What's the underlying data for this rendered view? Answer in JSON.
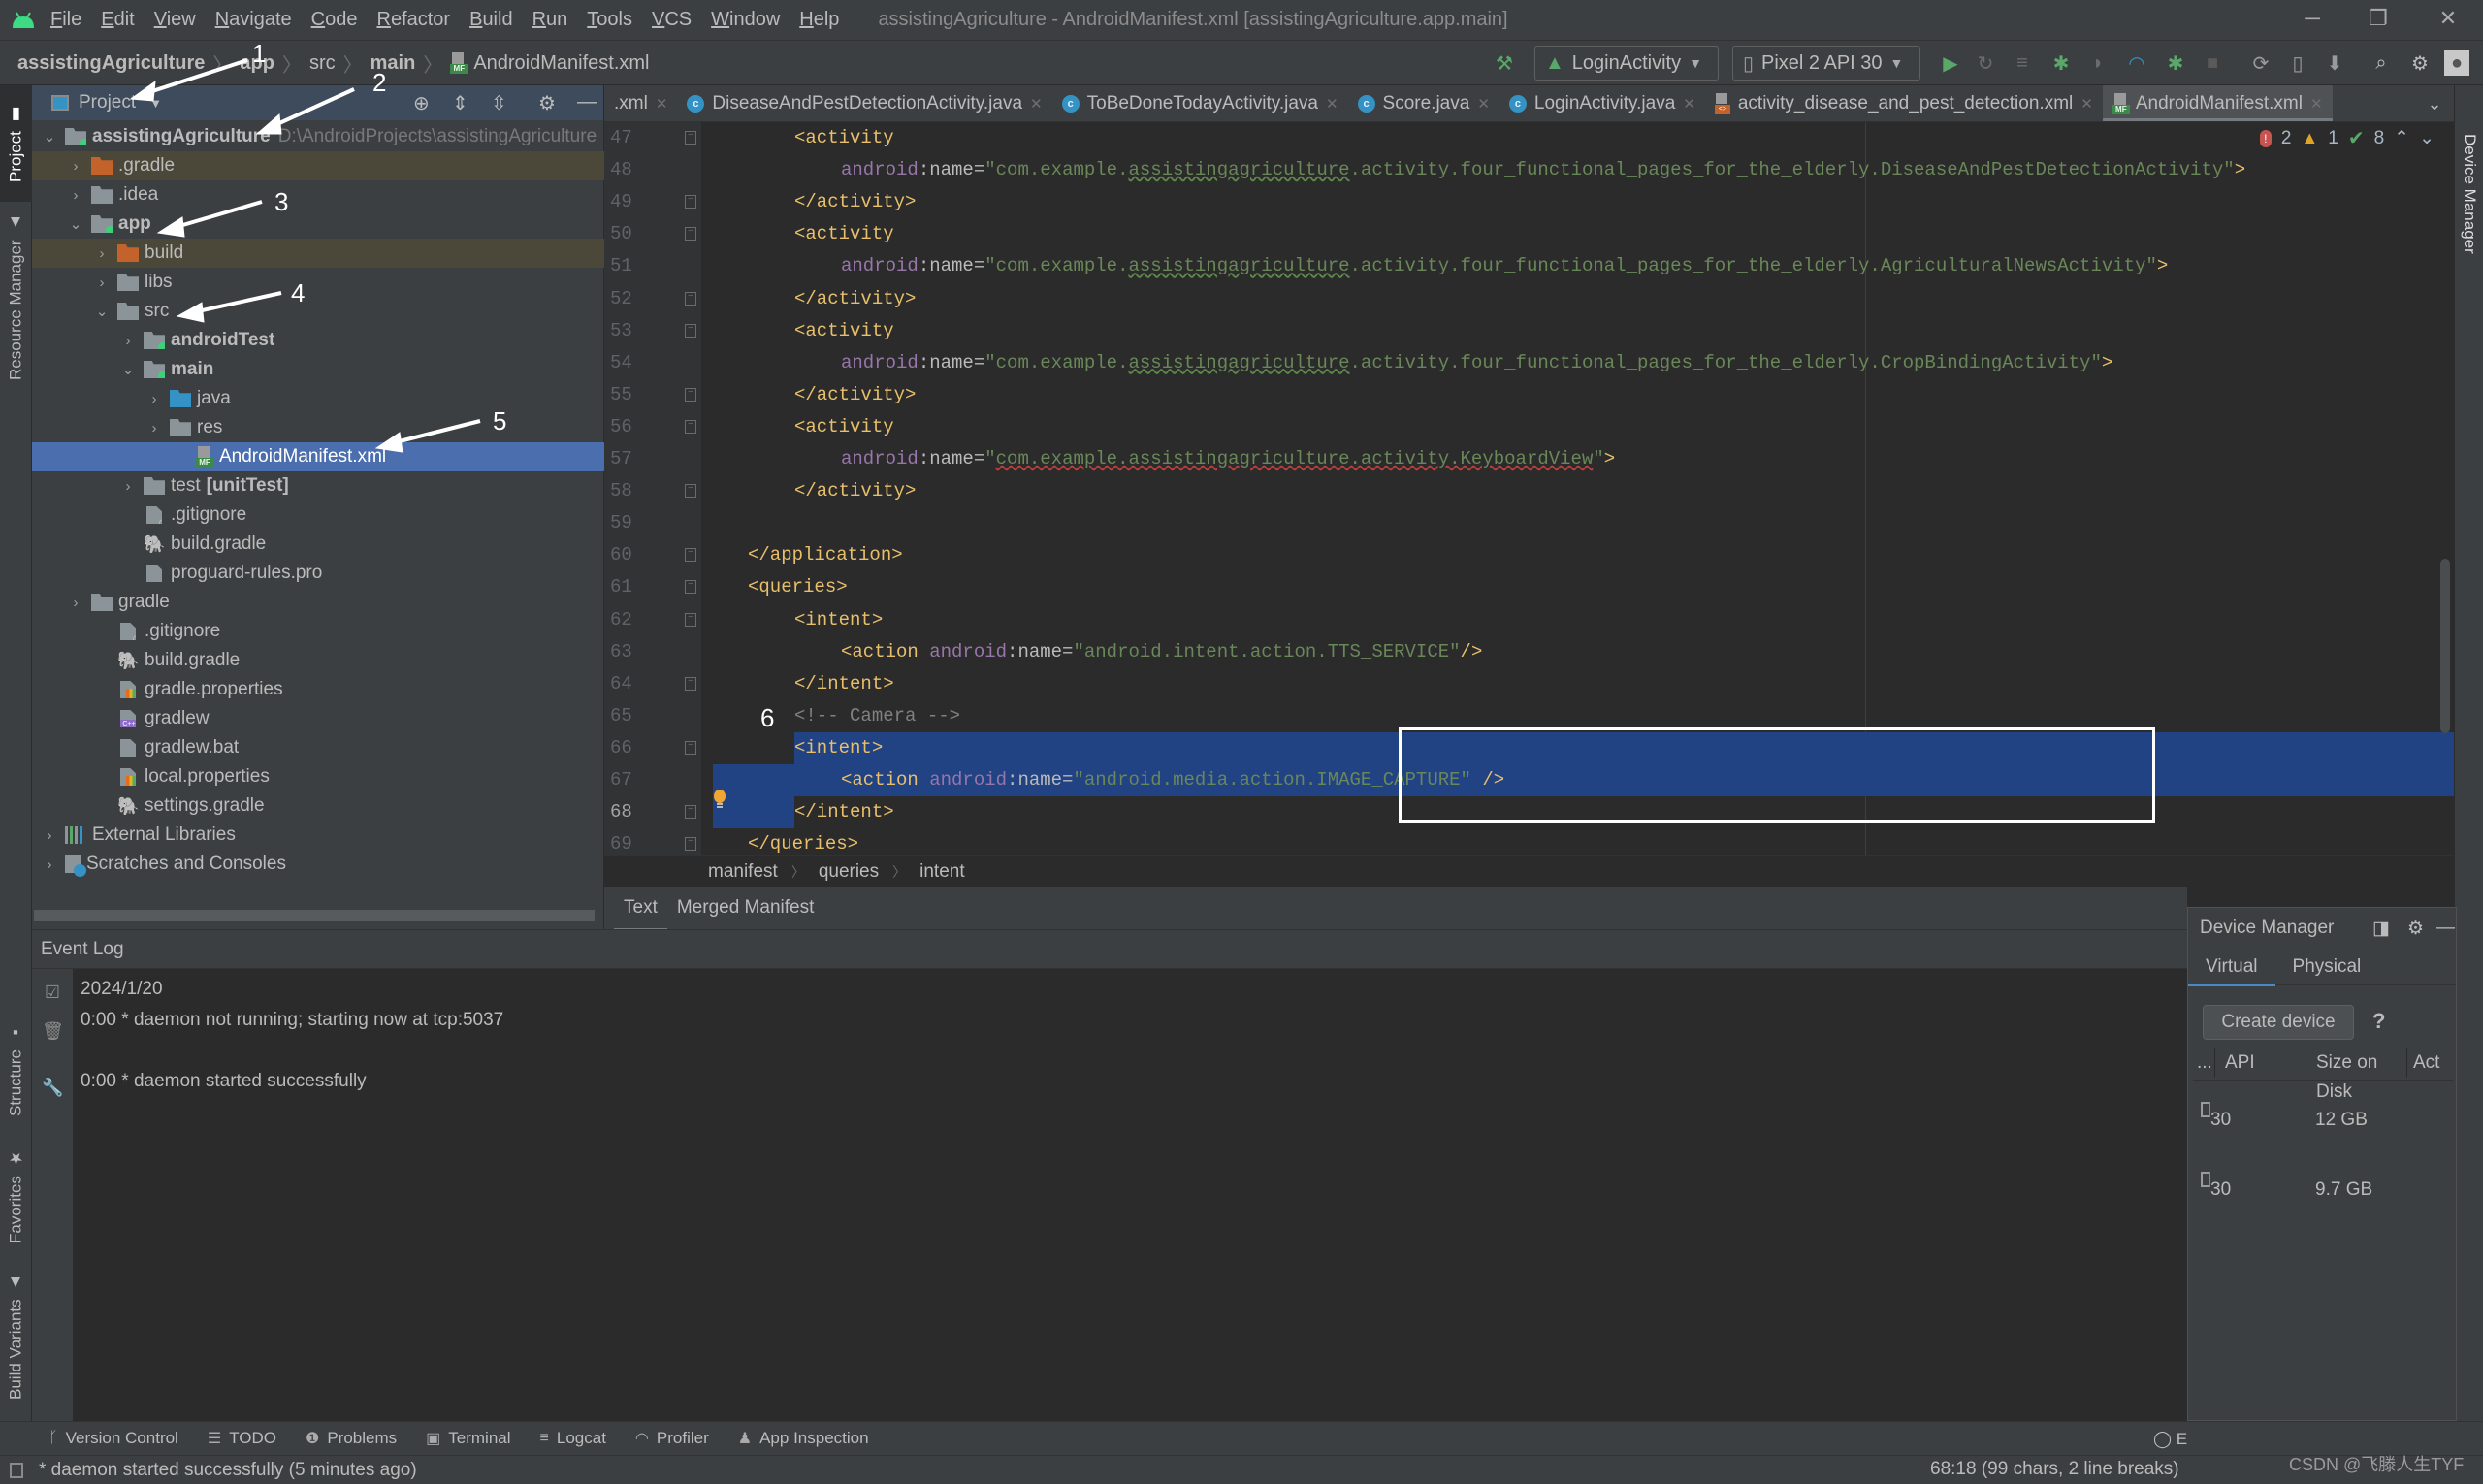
{
  "window": {
    "title": "assistingAgriculture - AndroidManifest.xml [assistingAgriculture.app.main]",
    "menu": [
      "File",
      "Edit",
      "View",
      "Navigate",
      "Code",
      "Refactor",
      "Build",
      "Run",
      "Tools",
      "VCS",
      "Window",
      "Help"
    ],
    "controls": {
      "minimize": "─",
      "restore": "❐",
      "close": "✕"
    }
  },
  "breadcrumb": {
    "items": [
      "assistingAgriculture",
      "app",
      "src",
      "main",
      "AndroidManifest.xml"
    ]
  },
  "toolbar": {
    "run_config": "LoginActivity",
    "device": "Pixel 2 API 30",
    "icons": [
      "hammer-icon",
      "run-icon",
      "rerun-icon",
      "apply-changes-icon",
      "debug-icon",
      "coverage-icon",
      "profile-icon",
      "attach-debugger-icon",
      "stop-icon",
      "sync-gradle-icon",
      "device-manager-icon",
      "sdk-manager-icon",
      "search-icon",
      "settings-icon",
      "account-icon"
    ]
  },
  "left_strip": {
    "top": [
      "Project",
      "Resource Manager"
    ],
    "bottom": [
      "Structure",
      "Favorites",
      "Build Variants"
    ]
  },
  "right_strip": {
    "label": "Device Manager"
  },
  "project_panel": {
    "view_mode": "Project",
    "tree": [
      {
        "label": "assistingAgriculture",
        "path": "D:\\AndroidProjects\\assistingAgriculture",
        "depth": 0,
        "expanded": true,
        "icon": "project",
        "bold": true
      },
      {
        "label": ".gradle",
        "depth": 1,
        "expanded": false,
        "icon": "folder-orange",
        "excluded": true
      },
      {
        "label": ".idea",
        "depth": 1,
        "expanded": false,
        "icon": "folder"
      },
      {
        "label": "app",
        "depth": 1,
        "expanded": true,
        "icon": "module",
        "bold": true
      },
      {
        "label": "build",
        "depth": 2,
        "expanded": false,
        "icon": "folder-orange",
        "excluded": true
      },
      {
        "label": "libs",
        "depth": 2,
        "expanded": false,
        "icon": "folder"
      },
      {
        "label": "src",
        "depth": 2,
        "expanded": true,
        "icon": "folder"
      },
      {
        "label": "androidTest",
        "depth": 3,
        "expanded": false,
        "icon": "module",
        "bold": true
      },
      {
        "label": "main",
        "depth": 3,
        "expanded": true,
        "icon": "module",
        "bold": true
      },
      {
        "label": "java",
        "depth": 4,
        "expanded": false,
        "icon": "folder-blue"
      },
      {
        "label": "res",
        "depth": 4,
        "expanded": false,
        "icon": "folder"
      },
      {
        "label": "AndroidManifest.xml",
        "depth": 5,
        "icon": "mf",
        "selected": true
      },
      {
        "label": "test",
        "suffix": "[unitTest]",
        "depth": 3,
        "expanded": false,
        "icon": "folder"
      },
      {
        "label": ".gitignore",
        "depth": 3,
        "icon": "ignore"
      },
      {
        "label": "build.gradle",
        "depth": 3,
        "icon": "gradle"
      },
      {
        "label": "proguard-rules.pro",
        "depth": 3,
        "icon": "file"
      },
      {
        "label": "gradle",
        "depth": 1,
        "expanded": false,
        "icon": "folder"
      },
      {
        "label": ".gitignore",
        "depth": 2,
        "icon": "ignore"
      },
      {
        "label": "build.gradle",
        "depth": 2,
        "icon": "gradle"
      },
      {
        "label": "gradle.properties",
        "depth": 2,
        "icon": "props"
      },
      {
        "label": "gradlew",
        "depth": 2,
        "icon": "cpp"
      },
      {
        "label": "gradlew.bat",
        "depth": 2,
        "icon": "file"
      },
      {
        "label": "local.properties",
        "depth": 2,
        "icon": "props"
      },
      {
        "label": "settings.gradle",
        "depth": 2,
        "icon": "gradle"
      },
      {
        "label": "External Libraries",
        "depth": 0,
        "expanded": false,
        "icon": "libs"
      },
      {
        "label": "Scratches and Consoles",
        "depth": 0,
        "expanded": false,
        "icon": "scratch"
      }
    ]
  },
  "annotations": [
    "1",
    "2",
    "3",
    "4",
    "5",
    "6"
  ],
  "editor": {
    "tabs": [
      {
        "label": ".xml",
        "icon": "xml",
        "partial": true
      },
      {
        "label": "DiseaseAndPestDetectionActivity.java",
        "icon": "class"
      },
      {
        "label": "ToBeDoneTodayActivity.java",
        "icon": "class"
      },
      {
        "label": "Score.java",
        "icon": "class"
      },
      {
        "label": "LoginActivity.java",
        "icon": "class"
      },
      {
        "label": "activity_disease_and_pest_detection.xml",
        "icon": "xml"
      },
      {
        "label": "AndroidManifest.xml",
        "icon": "mf",
        "active": true
      }
    ],
    "inspections": {
      "errors": "2",
      "warnings": "1",
      "ok": "8"
    },
    "lines": [
      {
        "n": "47",
        "indent": 2,
        "parts": [
          [
            "tag",
            "<activity"
          ]
        ]
      },
      {
        "n": "48",
        "indent": 3,
        "parts": [
          [
            "ns",
            "android"
          ],
          [
            "attr",
            ":name="
          ],
          [
            "str",
            "\"com.example."
          ],
          [
            "strg",
            "assistingagriculture"
          ],
          [
            "str",
            ".activity.four_functional_pages_for_the_elderly.DiseaseAndPestDetectionActivity\""
          ],
          [
            "tag",
            ">"
          ]
        ]
      },
      {
        "n": "49",
        "indent": 2,
        "parts": [
          [
            "tag",
            "</activity>"
          ]
        ]
      },
      {
        "n": "50",
        "indent": 2,
        "parts": [
          [
            "tag",
            "<activity"
          ]
        ]
      },
      {
        "n": "51",
        "indent": 3,
        "parts": [
          [
            "ns",
            "android"
          ],
          [
            "attr",
            ":name="
          ],
          [
            "str",
            "\"com.example."
          ],
          [
            "strg",
            "assistingagriculture"
          ],
          [
            "str",
            ".activity.four_functional_pages_for_the_elderly.AgriculturalNewsActivity\""
          ],
          [
            "tag",
            ">"
          ]
        ]
      },
      {
        "n": "52",
        "indent": 2,
        "parts": [
          [
            "tag",
            "</activity>"
          ]
        ]
      },
      {
        "n": "53",
        "indent": 2,
        "parts": [
          [
            "tag",
            "<activity"
          ]
        ]
      },
      {
        "n": "54",
        "indent": 3,
        "parts": [
          [
            "ns",
            "android"
          ],
          [
            "attr",
            ":name="
          ],
          [
            "str",
            "\"com.example."
          ],
          [
            "strg",
            "assistingagriculture"
          ],
          [
            "str",
            ".activity.four_functional_pages_for_the_elderly.CropBindingActivity\""
          ],
          [
            "tag",
            ">"
          ]
        ]
      },
      {
        "n": "55",
        "indent": 2,
        "parts": [
          [
            "tag",
            "</activity>"
          ]
        ]
      },
      {
        "n": "56",
        "indent": 2,
        "parts": [
          [
            "tag",
            "<activity"
          ]
        ]
      },
      {
        "n": "57",
        "indent": 3,
        "parts": [
          [
            "ns",
            "android"
          ],
          [
            "attr",
            ":name="
          ],
          [
            "str",
            "\""
          ],
          [
            "strr",
            "com.example.assistingagriculture.activity.KeyboardView"
          ],
          [
            "str",
            "\""
          ],
          [
            "tag",
            ">"
          ]
        ]
      },
      {
        "n": "58",
        "indent": 2,
        "parts": [
          [
            "tag",
            "</activity>"
          ]
        ]
      },
      {
        "n": "59",
        "indent": 0,
        "parts": []
      },
      {
        "n": "60",
        "indent": 1,
        "parts": [
          [
            "tag",
            "</application>"
          ]
        ]
      },
      {
        "n": "61",
        "indent": 1,
        "parts": [
          [
            "tag",
            "<queries>"
          ]
        ]
      },
      {
        "n": "62",
        "indent": 2,
        "parts": [
          [
            "tag",
            "<intent>"
          ]
        ]
      },
      {
        "n": "63",
        "indent": 3,
        "parts": [
          [
            "tag",
            "<action "
          ],
          [
            "ns",
            "android"
          ],
          [
            "attr",
            ":name="
          ],
          [
            "str",
            "\"android.intent.action.TTS_SERVICE\""
          ],
          [
            "tag",
            "/>"
          ]
        ]
      },
      {
        "n": "64",
        "indent": 2,
        "parts": [
          [
            "tag",
            "</intent>"
          ]
        ]
      },
      {
        "n": "65",
        "indent": 2,
        "parts": [
          [
            "cmt",
            "<!-- Camera -->"
          ]
        ]
      },
      {
        "n": "66",
        "indent": 2,
        "parts": [
          [
            "tag",
            "<intent>"
          ]
        ],
        "selected": true
      },
      {
        "n": "67",
        "indent": 3,
        "parts": [
          [
            "tag",
            "<action "
          ],
          [
            "ns",
            "android"
          ],
          [
            "attr",
            ":name="
          ],
          [
            "str",
            "\"android.media.action.IMAGE_CAPTURE\""
          ],
          [
            "attr",
            " "
          ],
          [
            "tag",
            "/>"
          ]
        ],
        "selected": true
      },
      {
        "n": "68",
        "indent": 2,
        "parts": [
          [
            "tag",
            "</intent>"
          ]
        ],
        "selected": true,
        "current": true
      },
      {
        "n": "69",
        "indent": 1,
        "parts": [
          [
            "tag",
            "</queries>"
          ]
        ]
      }
    ],
    "crumbs": [
      "manifest",
      "queries",
      "intent"
    ],
    "subtabs": [
      {
        "label": "Text",
        "active": true
      },
      {
        "label": "Merged Manifest"
      }
    ]
  },
  "event_log": {
    "title": "Event Log",
    "date": "2024/1/20",
    "entries": [
      {
        "time": "0:00",
        "text": "* daemon not running; starting now at tcp:5037"
      },
      {
        "time": "0:00",
        "text": "* daemon started successfully"
      }
    ]
  },
  "device_manager": {
    "title": "Device Manager",
    "tabs": [
      {
        "label": "Virtual",
        "active": true
      },
      {
        "label": "Physical"
      }
    ],
    "create_button": "Create device",
    "help": "?",
    "columns": [
      "...",
      "API",
      "Size on Disk",
      "Act"
    ],
    "rows": [
      {
        "api": "30",
        "size": "12 GB"
      },
      {
        "api": "30",
        "size": "9.7 GB"
      }
    ]
  },
  "tool_tabs": [
    "Version Control",
    "TODO",
    "Problems",
    "Terminal",
    "Logcat",
    "Profiler",
    "App Inspection"
  ],
  "event_log_button": "E",
  "status_bar": {
    "message": "* daemon started successfully (5 minutes ago)",
    "position": "68:18 (99 chars, 2 line breaks)",
    "watermark": "CSDN @飞滕人生TYF"
  }
}
